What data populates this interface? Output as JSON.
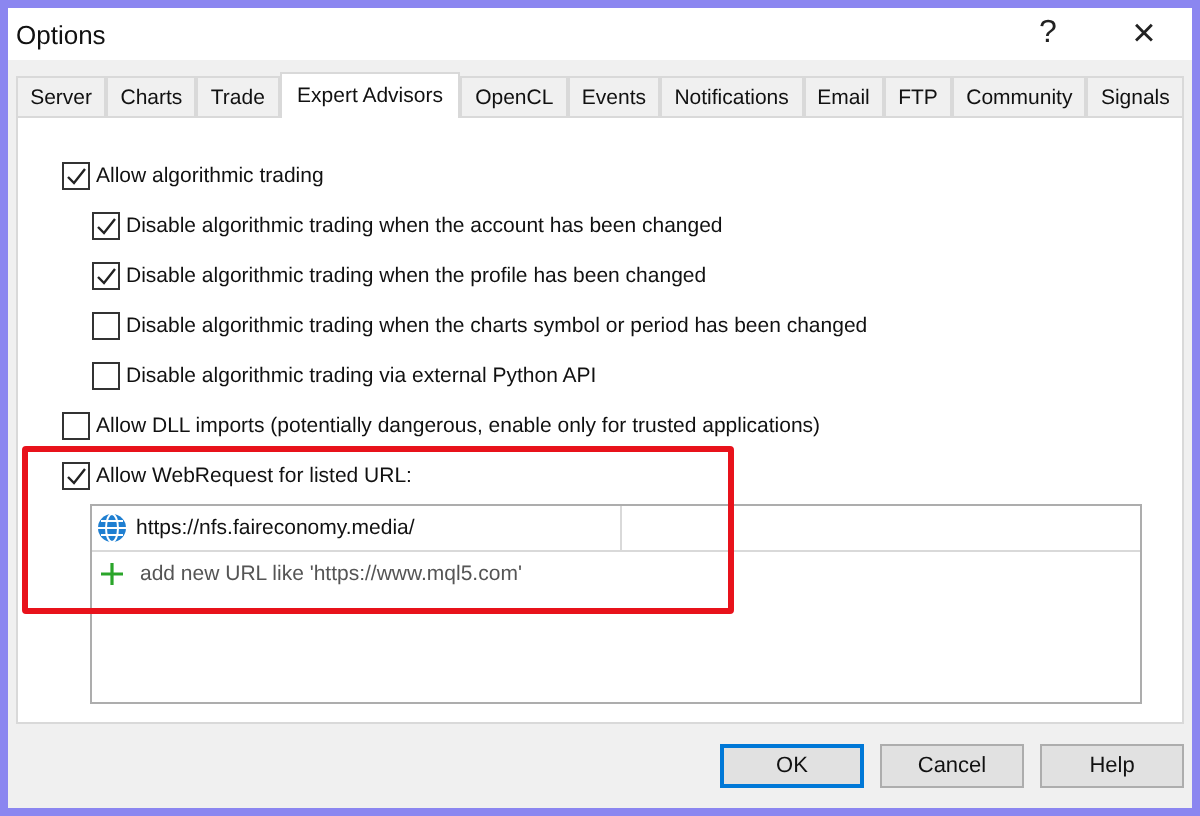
{
  "window": {
    "title": "Options",
    "help": "?",
    "close": "×"
  },
  "tabs": [
    {
      "label": "Server",
      "selected": false
    },
    {
      "label": "Charts",
      "selected": false
    },
    {
      "label": "Trade",
      "selected": false
    },
    {
      "label": "Expert Advisors",
      "selected": true
    },
    {
      "label": "OpenCL",
      "selected": false
    },
    {
      "label": "Events",
      "selected": false
    },
    {
      "label": "Notifications",
      "selected": false
    },
    {
      "label": "Email",
      "selected": false
    },
    {
      "label": "FTP",
      "selected": false
    },
    {
      "label": "Community",
      "selected": false
    },
    {
      "label": "Signals",
      "selected": false
    }
  ],
  "options": [
    {
      "label": "Allow algorithmic trading",
      "checked": true,
      "children": [
        {
          "label": "Disable algorithmic trading when the account has been changed",
          "checked": true
        },
        {
          "label": "Disable algorithmic trading when the profile has been changed",
          "checked": true
        },
        {
          "label": "Disable algorithmic trading when the charts symbol or period has been changed",
          "checked": false
        },
        {
          "label": "Disable algorithmic trading via external Python API",
          "checked": false
        }
      ]
    },
    {
      "label": "Allow DLL imports (potentially dangerous, enable only for trusted applications)",
      "checked": false
    },
    {
      "label": "Allow WebRequest for listed URL:",
      "checked": true,
      "highlight": true
    }
  ],
  "url_list": {
    "urls": [
      "https://nfs.faireconomy.media/"
    ],
    "add_hint": "add new URL like 'https://www.mql5.com'"
  },
  "buttons": [
    "OK",
    "Cancel",
    "Help"
  ]
}
